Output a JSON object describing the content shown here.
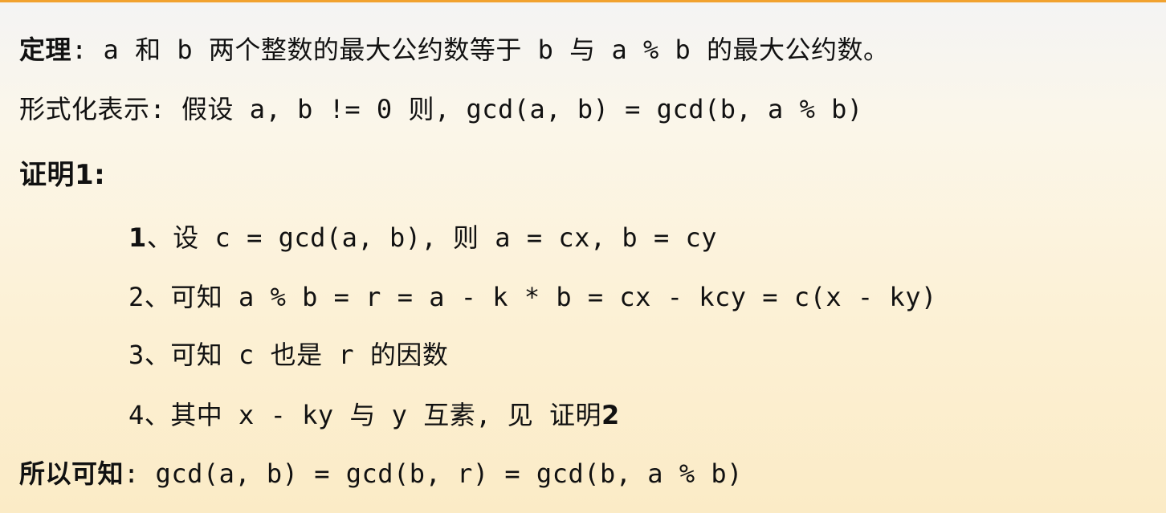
{
  "colors": {
    "accent_rule": "#f1a22f",
    "text": "#111111"
  },
  "theorem": {
    "label": "定理",
    "sep": ": ",
    "text": "a 和 b 两个整数的最大公约数等于 b 与 a % b 的最大公约数。"
  },
  "formal": {
    "text": "形式化表示: 假设 a, b != 0 则, gcd(a, b) = gcd(b, a % b)"
  },
  "proof1": {
    "heading": "证明1:"
  },
  "steps": [
    {
      "num": "1",
      "text": "、设 c = gcd(a, b), 则 a = cx, b = cy"
    },
    {
      "num": "2",
      "text": "、可知 a % b = r = a - k * b = cx - kcy = c(x - ky)"
    },
    {
      "num": "3",
      "text": "、可知 c 也是 r 的因数"
    },
    {
      "num": "4",
      "text": "、其中 x - ky 与 y 互素, 见 证明",
      "ref": "2"
    }
  ],
  "conclusion": {
    "label": "所以可知",
    "text": ": gcd(a, b) = gcd(b, r) = gcd(b, a % b)"
  }
}
